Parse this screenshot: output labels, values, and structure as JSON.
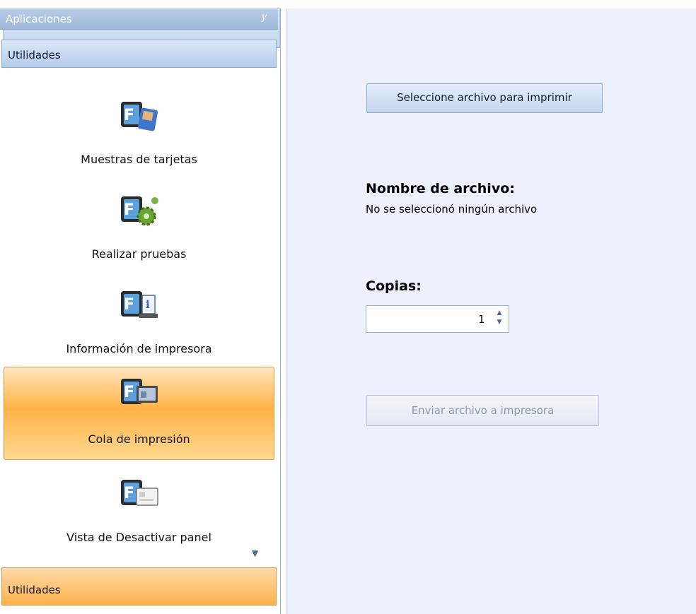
{
  "sidebar": {
    "title": "Aplicaciones",
    "pin_icon": "pin-icon",
    "group_top": "Utilidades",
    "group_bottom": "Utilidades",
    "items": [
      {
        "label": "Muestras de tarjetas",
        "icon": "card-samples-icon",
        "selected": false
      },
      {
        "label": "Realizar pruebas",
        "icon": "run-tests-icon",
        "selected": false
      },
      {
        "label": "Información de impresora",
        "icon": "printer-info-icon",
        "selected": false
      },
      {
        "label": "Cola de impresión",
        "icon": "print-queue-icon",
        "selected": true
      },
      {
        "label": "Vista de Desactivar panel",
        "icon": "disable-panel-view-icon",
        "selected": false
      }
    ]
  },
  "main": {
    "select_button": "Seleccione archivo para imprimir",
    "filename_label": "Nombre de archivo:",
    "filename_value": "No se seleccionó ningún archivo",
    "copies_label": "Copias:",
    "copies_value": "1",
    "send_button": "Enviar archivo a impresora"
  },
  "colors": {
    "selected_item": "#ffb347",
    "panel_background": "#ecf1fb",
    "header_blue": "#9fb8da"
  }
}
